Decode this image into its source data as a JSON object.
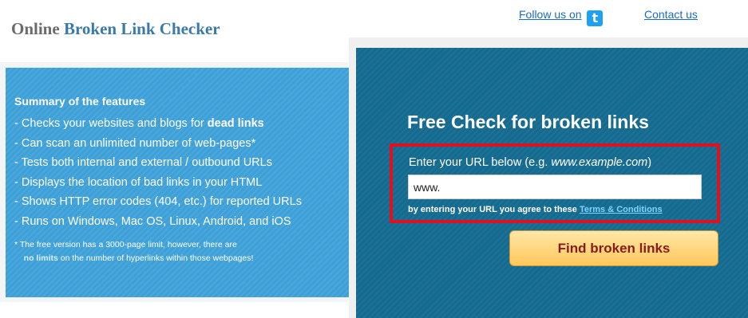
{
  "header": {
    "title_prefix": "Online",
    "title_accent": "Broken Link Checker",
    "follow_label": "Follow us on",
    "twitter_icon_glyph": "t",
    "contact_label": "Contact us"
  },
  "features": {
    "heading": "Summary of the features",
    "items": [
      {
        "text": "- Checks your websites and blogs for ",
        "bold": "dead links"
      },
      {
        "text": "- Can scan an unlimited number of web-pages*",
        "bold": ""
      },
      {
        "text": "- Tests both internal and external / outbound URLs",
        "bold": ""
      },
      {
        "text": "- Displays the location of bad links in your HTML",
        "bold": ""
      },
      {
        "text": "- Shows HTTP error codes (404, etc.) for reported URLs",
        "bold": ""
      },
      {
        "text": "- Runs on Windows, Mac OS, Linux, Android, and iOS",
        "bold": ""
      }
    ],
    "note_line1": "*  The free version has a 3000-page limit, however, there are",
    "note_no_limits": "no limits",
    "note_line2": " on the number of hyperlinks within those webpages!"
  },
  "check": {
    "title": "Free Check for broken links",
    "prompt_text": "Enter your URL below (e.g. ",
    "prompt_example": "www.example.com",
    "prompt_end": ")",
    "url_value": "www.",
    "agree_text": "by entering your URL you agree to these ",
    "terms_label": "Terms & Conditions",
    "button_label": "Find broken links"
  },
  "colors": {
    "features_bg": "#3ea0d8",
    "check_bg": "#146b8f",
    "highlight_border": "#e0101e",
    "button_text": "#8b1a1a",
    "link": "#1a6bc4"
  }
}
